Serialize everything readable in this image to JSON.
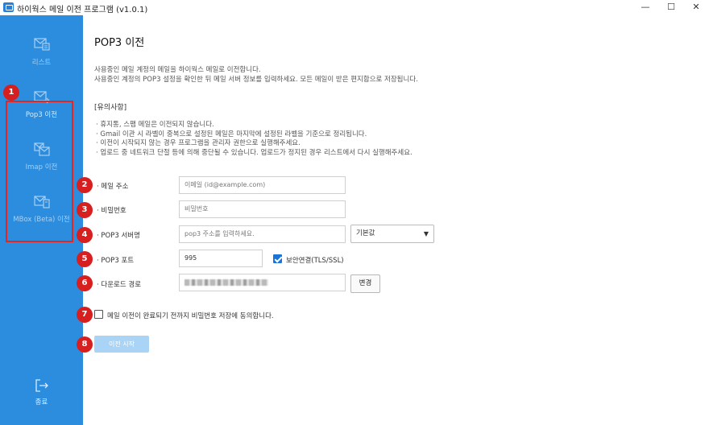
{
  "window": {
    "title": "하이웍스 메일 이전 프로그램 (v1.0.1)",
    "minimize": "—",
    "maximize": "☐",
    "close": "✕"
  },
  "sidebar": {
    "items": [
      {
        "label": "리스트",
        "icon": "list-mail-icon"
      },
      {
        "label": "Pop3 이전",
        "icon": "mail-transfer-icon"
      },
      {
        "label": "Imap 이전",
        "icon": "mail-transfer-icon"
      },
      {
        "label": "MBox (Beta) 이전",
        "icon": "mailbox-transfer-icon"
      }
    ],
    "exit_label": "종료",
    "exit_icon": "exit-icon",
    "bg_color": "#2c8cde"
  },
  "main": {
    "title": "POP3 이전",
    "description": [
      "사용중인 메일 계정의 메일을 하이웍스 메일로 이전합니다.",
      "사용중인 계정의 POP3 설정을 확인한 뒤 메일 서버 정보를 입력하세요. 모든 메일이 받은 편지함으로 저장됩니다."
    ],
    "notice_title": "[유의사항]",
    "notices": [
      "·  휴지통, 스팸 메일은 이전되지 않습니다.",
      "·  Gmail 이관 시 라벨이 중복으로 설정된 메일은 마지막에 설정된 라벨을 기준으로 정리됩니다.",
      "·  이전이 시작되지 않는 경우 프로그램을 관리자 권한으로 실행해주세요.",
      "·  업로드 중 네트워크 단절 등에 의해 중단될 수 있습니다. 업로드가 정지된 경우 리스트에서 다시 실행해주세요."
    ]
  },
  "form": {
    "email_label": "·  메일 주소",
    "email_placeholder": "이메일 (id@example.com)",
    "password_label": "·  비밀번호",
    "password_placeholder": "비밀번호",
    "server_label": "·  POP3 서버명",
    "server_placeholder": "pop3 주소를 입력하세요.",
    "server_select": "기본값",
    "port_label": "·  POP3 포트",
    "port_value": "995",
    "ssl_label": "보안연결(TLS/SSL)",
    "ssl_checked": true,
    "download_label": "·  다운로드 경로",
    "change_button": "변경",
    "agree_label": "메일 이전이 완료되기 전까지 비밀번호 저장에 동의합니다.",
    "agree_checked": false,
    "start_button": "이전 시작"
  },
  "markers": [
    "1",
    "2",
    "3",
    "4",
    "5",
    "6",
    "7",
    "8"
  ],
  "colors": {
    "accent": "#2c8cde",
    "marker": "#d81f1f",
    "start_button": "#a9d4f5"
  }
}
